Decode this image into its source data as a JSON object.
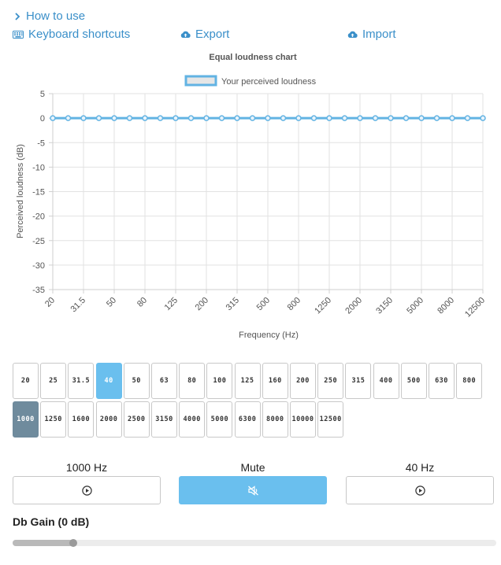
{
  "nav": {
    "how_to_use": "How to use",
    "keyboard_shortcuts": "Keyboard shortcuts",
    "export": "Export",
    "import": "Import"
  },
  "chart_data": {
    "type": "line",
    "title": "Equal loudness chart",
    "xlabel": "Frequency (Hz)",
    "ylabel": "Perceived loudness (dB)",
    "ylim": [
      -35,
      5
    ],
    "yticks": [
      "5",
      "0",
      "-5",
      "-10",
      "-15",
      "-20",
      "-25",
      "-30",
      "-35"
    ],
    "grid": true,
    "legend_position": "top",
    "categories": [
      "20",
      "25",
      "31.5",
      "40",
      "50",
      "63",
      "80",
      "100",
      "125",
      "160",
      "200",
      "250",
      "315",
      "400",
      "500",
      "630",
      "800",
      "1000",
      "1250",
      "1600",
      "2000",
      "2500",
      "3150",
      "4000",
      "5000",
      "6300",
      "8000",
      "10000",
      "12500"
    ],
    "x_tick_labels": [
      "20",
      "31.5",
      "50",
      "80",
      "125",
      "200",
      "315",
      "500",
      "800",
      "1250",
      "2000",
      "3150",
      "5000",
      "8000",
      "12500"
    ],
    "series": [
      {
        "name": "Your perceived loudness",
        "color": "#62b3e3",
        "values": [
          0,
          0,
          0,
          0,
          0,
          0,
          0,
          0,
          0,
          0,
          0,
          0,
          0,
          0,
          0,
          0,
          0,
          0,
          0,
          0,
          0,
          0,
          0,
          0,
          0,
          0,
          0,
          0,
          0
        ]
      }
    ]
  },
  "frequency_buttons": [
    "20",
    "25",
    "31.5",
    "40",
    "50",
    "63",
    "80",
    "100",
    "125",
    "160",
    "200",
    "250",
    "315",
    "400",
    "500",
    "630",
    "800",
    "1000",
    "1250",
    "1600",
    "2000",
    "2500",
    "3150",
    "4000",
    "5000",
    "6300",
    "8000",
    "10000",
    "12500"
  ],
  "selected_reference": "1000",
  "selected_test": "40",
  "controls": {
    "left_label": "1000 Hz",
    "center_label": "Mute",
    "right_label": "40 Hz"
  },
  "gain": {
    "label": "Db Gain (0 dB)",
    "value": 0,
    "slider_fraction": 0.13
  },
  "colors": {
    "accent": "#3a8fc9",
    "selected_test": "#6abfee",
    "selected_reference": "#6f8b9d",
    "line": "#62b3e3"
  }
}
